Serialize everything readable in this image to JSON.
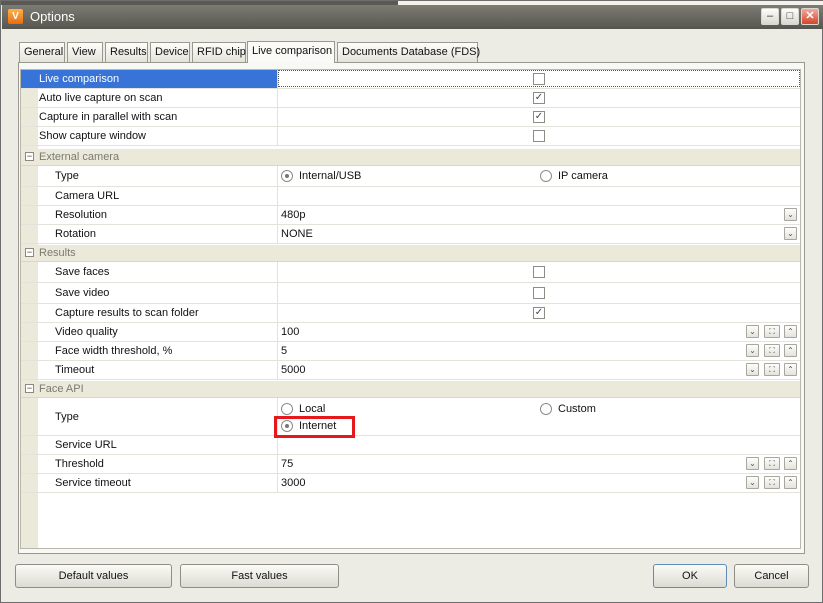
{
  "window": {
    "title": "Options",
    "app_icon": "V",
    "minimize": "‒",
    "maximize": "□",
    "close": "✕"
  },
  "tabs": [
    "General",
    "View",
    "Results",
    "Device",
    "RFID chip",
    "Live comparison",
    "Documents Database (FDS)"
  ],
  "active_tab": "Live comparison",
  "props": {
    "live_comparison": {
      "label": "Live comparison",
      "checked": false
    },
    "auto_live": {
      "label": "Auto live capture on scan",
      "checked": true
    },
    "capture_parallel": {
      "label": "Capture in parallel with scan",
      "checked": true
    },
    "show_window": {
      "label": "Show capture window",
      "checked": false
    }
  },
  "external_camera": {
    "header": "External camera",
    "type_label": "Type",
    "opt_internal": "Internal/USB",
    "opt_ip": "IP camera",
    "selected": "Internal/USB",
    "url_label": "Camera URL",
    "url_value": "",
    "resolution_label": "Resolution",
    "resolution_value": "480p",
    "rotation_label": "Rotation",
    "rotation_value": "NONE"
  },
  "results": {
    "header": "Results",
    "save_faces_label": "Save faces",
    "save_faces": false,
    "save_video_label": "Save video",
    "save_video": false,
    "capture_folder_label": "Capture results to scan folder",
    "capture_folder": true,
    "video_quality_label": "Video quality",
    "video_quality_value": "100",
    "face_width_label": "Face width threshold, %",
    "face_width_value": "5",
    "timeout_label": "Timeout",
    "timeout_value": "5000"
  },
  "face_api": {
    "header": "Face API",
    "type_label": "Type",
    "opt_local": "Local",
    "opt_custom": "Custom",
    "opt_internet": "Internet",
    "selected": "Internet",
    "service_url_label": "Service URL",
    "service_url_value": "",
    "threshold_label": "Threshold",
    "threshold_value": "75",
    "service_timeout_label": "Service timeout",
    "service_timeout_value": "3000"
  },
  "glyphs": {
    "check": "✓",
    "collapse": "−",
    "dropdown": "⌄",
    "spin_down": "⌄",
    "spin_up": "⌃",
    "spin_reset": "⛶"
  },
  "buttons": {
    "default_values": "Default values",
    "fast_values": "Fast values",
    "ok": "OK",
    "cancel": "Cancel"
  },
  "colors": {
    "selection": "#3874d8",
    "highlight_box": "#e3191d",
    "category_bg": "#ebe9d9"
  }
}
